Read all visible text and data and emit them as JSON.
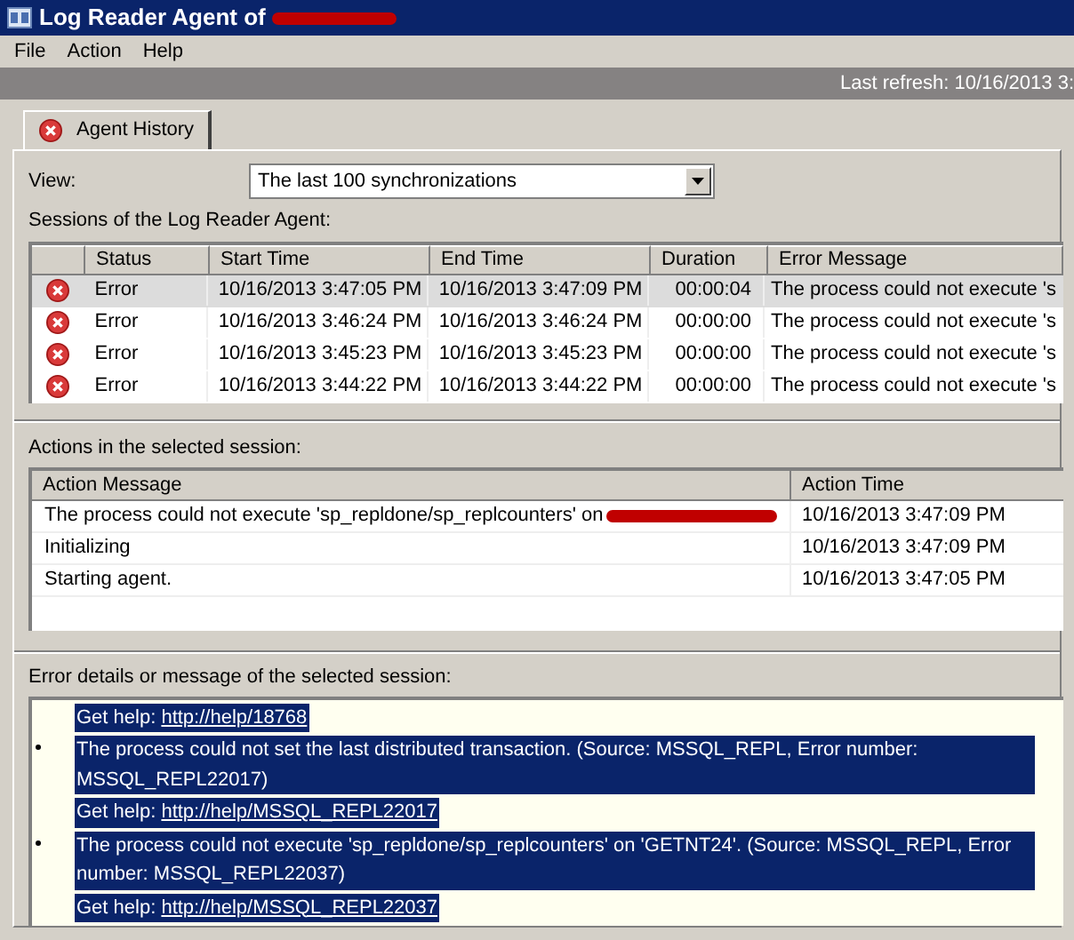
{
  "window": {
    "title": "Log Reader Agent of",
    "title_redacted": true
  },
  "menu": [
    "File",
    "Action",
    "Help"
  ],
  "refresh_bar": {
    "text": "Last refresh: 10/16/2013 3:"
  },
  "tabs": [
    {
      "label": "Agent History",
      "selected": true
    }
  ],
  "view": {
    "label": "View:",
    "value": "The last 100 synchronizations"
  },
  "sessions": {
    "label": "Sessions of the Log Reader Agent:",
    "columns": [
      "Status",
      "Start Time",
      "End Time",
      "Duration",
      "Error Message"
    ],
    "rows": [
      {
        "status": "Error",
        "start": "10/16/2013 3:47:05 PM",
        "end": "10/16/2013 3:47:09 PM",
        "duration": "00:00:04",
        "error": "The process could not execute 's",
        "selected": true
      },
      {
        "status": "Error",
        "start": "10/16/2013 3:46:24 PM",
        "end": "10/16/2013 3:46:24 PM",
        "duration": "00:00:00",
        "error": "The process could not execute 's",
        "selected": false
      },
      {
        "status": "Error",
        "start": "10/16/2013 3:45:23 PM",
        "end": "10/16/2013 3:45:23 PM",
        "duration": "00:00:00",
        "error": "The process could not execute 's",
        "selected": false
      },
      {
        "status": "Error",
        "start": "10/16/2013 3:44:22 PM",
        "end": "10/16/2013 3:44:22 PM",
        "duration": "00:00:00",
        "error": "The process could not execute 's",
        "selected": false
      }
    ]
  },
  "actions": {
    "label": "Actions in the selected session:",
    "columns": [
      "Action Message",
      "Action Time"
    ],
    "rows": [
      {
        "message": "The process could not execute 'sp_repldone/sp_replcounters' on",
        "redacted": true,
        "time": "10/16/2013 3:47:09 PM"
      },
      {
        "message": "Initializing",
        "redacted": false,
        "time": "10/16/2013 3:47:09 PM"
      },
      {
        "message": "Starting agent.",
        "redacted": false,
        "time": "10/16/2013 3:47:05 PM"
      }
    ]
  },
  "details": {
    "label": "Error details or message of the selected session:",
    "text_selected": true,
    "lines": [
      {
        "kind": "help",
        "label": "Get help:",
        "link": "http://help/18768"
      },
      {
        "kind": "bullet",
        "text": "The process could not set the last distributed transaction. (Source: MSSQL_REPL, Error number: MSSQL_REPL22017)"
      },
      {
        "kind": "help",
        "label": "Get help:",
        "link": "http://help/MSSQL_REPL22017"
      },
      {
        "kind": "bullet",
        "text": "The process could not execute 'sp_repldone/sp_replcounters' on 'GETNT24'. (Source: MSSQL_REPL, Error number: MSSQL_REPL22037)"
      },
      {
        "kind": "help",
        "label": "Get help:",
        "link": "http://help/MSSQL_REPL22037"
      }
    ]
  }
}
